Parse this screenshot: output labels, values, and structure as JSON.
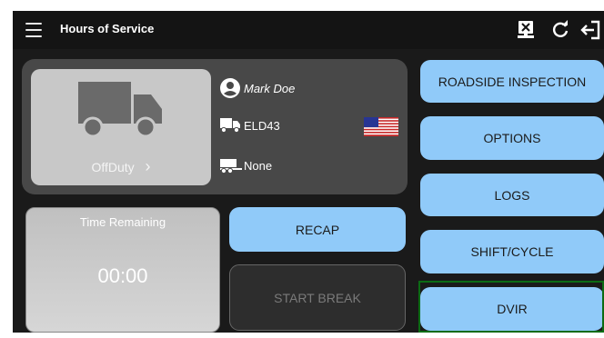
{
  "header": {
    "title": "Hours of Service"
  },
  "driver": {
    "name": "Mark Doe",
    "vehicle": "ELD43",
    "trailer": "None"
  },
  "duty": {
    "status": "OffDuty",
    "chevron": "›"
  },
  "time_card": {
    "label": "Time Remaining",
    "value": "00:00"
  },
  "buttons": {
    "recap": "RECAP",
    "start_break": "START BREAK",
    "roadside": "ROADSIDE INSPECTION",
    "options": "OPTIONS",
    "logs": "LOGS",
    "shift_cycle": "SHIFT/CYCLE",
    "dvir": "DVIR"
  },
  "colors": {
    "button_blue": "#90caf9",
    "highlight_green": "#0c6b14",
    "panel": "#484848"
  },
  "icons": [
    "menu-icon",
    "sync-icon",
    "refresh-icon",
    "logout-icon",
    "truck-icon",
    "user-icon",
    "trailer-icon",
    "us-flag-icon",
    "chevron-right-icon"
  ]
}
